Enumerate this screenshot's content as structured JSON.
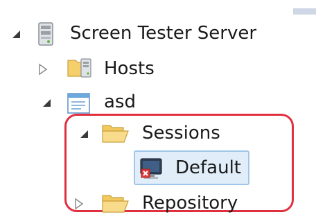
{
  "tree": {
    "root": {
      "label": "Screen Tester Server",
      "icon": "server-icon",
      "expanded": true
    },
    "hosts": {
      "label": "Hosts",
      "icon": "hosts-folder-icon",
      "expanded": false
    },
    "asd": {
      "label": "asd",
      "icon": "window-icon",
      "expanded": true
    },
    "sessions": {
      "label": "Sessions",
      "icon": "folder-open-icon",
      "expanded": true
    },
    "default": {
      "label": "Default",
      "icon": "session-screen-icon",
      "selected": true
    },
    "repository": {
      "label": "Repository",
      "icon": "folder-open-icon",
      "expanded": false
    }
  },
  "colors": {
    "highlight_border": "#e03040",
    "selection_bg": "#e1eef9",
    "selection_border": "#9fc6e8"
  }
}
